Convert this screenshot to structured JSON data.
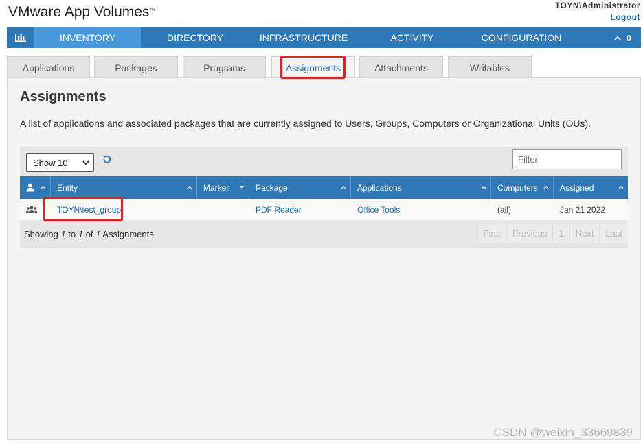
{
  "header": {
    "app_title": "VMware App Volumes",
    "trademark": "™",
    "user": "TOYN\\Administrator",
    "logout": "Logout"
  },
  "nav": {
    "dashboard_icon": "bar-chart-icon",
    "items": [
      {
        "label": "INVENTORY",
        "active": true
      },
      {
        "label": "DIRECTORY",
        "active": false
      },
      {
        "label": "INFRASTRUCTURE",
        "active": false
      },
      {
        "label": "ACTIVITY",
        "active": false
      },
      {
        "label": "CONFIGURATION",
        "active": false
      }
    ],
    "notifications_count": "0"
  },
  "tabs": [
    {
      "label": "Applications"
    },
    {
      "label": "Packages"
    },
    {
      "label": "Programs"
    },
    {
      "label": "Assignments",
      "active": true
    },
    {
      "label": "Attachments"
    },
    {
      "label": "Writables"
    }
  ],
  "page": {
    "title": "Assignments",
    "description": "A list of applications and associated packages that are currently assigned to Users, Groups, Computers or Organizational Units (OUs)."
  },
  "toolbar": {
    "show_select": "Show 10",
    "filter_placeholder": "Filter"
  },
  "table": {
    "columns": [
      "",
      "Entity",
      "Marker",
      "Package",
      "Applications",
      "Computers",
      "Assigned"
    ],
    "rows": [
      {
        "type_icon": "group-icon",
        "entity": "TOYN\\test_group",
        "marker": "",
        "package": "PDF Reader",
        "applications": "Office Tools",
        "computers": "(all)",
        "assigned": "Jan 21 2022"
      }
    ]
  },
  "footer": {
    "showing_prefix": "Showing",
    "from": "1",
    "to_word": "to",
    "to": "1",
    "of_word": "of",
    "total": "1",
    "suffix": "Assignments",
    "pager": [
      "First",
      "Previous",
      "1",
      "Next",
      "Last"
    ]
  },
  "watermark": "CSDN @weixin_33669839",
  "colors": {
    "brand_blue": "#2f79b9",
    "active_nav": "#4a98dc",
    "link": "#1a6fb5",
    "highlight": "#e8201c"
  }
}
